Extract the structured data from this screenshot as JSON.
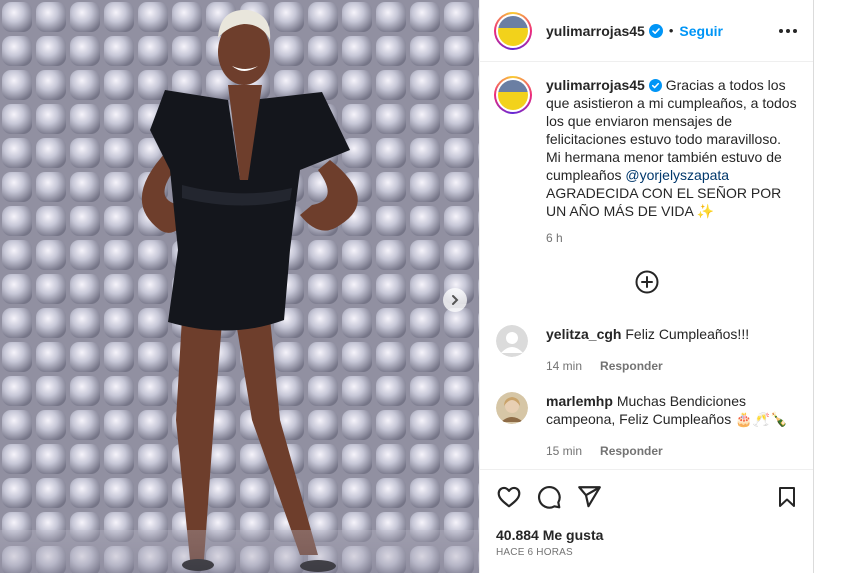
{
  "post": {
    "username": "yulimarrojas45",
    "dot": "•",
    "follow_label": "Seguir",
    "caption_text": "Gracias a todos los que asistieron a mi cumpleaños, a todos los que enviaron mensajes de felicitaciones estuvo todo maravilloso. Mi hermana menor también estuvo de cumpleaños ",
    "caption_mention": "@yorjelyszapata",
    "caption_end": " AGRADECIDA CON EL SEÑOR POR UN AÑO MÁS DE VIDA ✨",
    "caption_time": "6 h"
  },
  "comments": [
    {
      "username": "yelitza_cgh",
      "text": "Feliz Cumpleaños!!!",
      "time": "14 min",
      "reply_label": "Responder"
    },
    {
      "username": "marlemhp",
      "text": "Muchas Bendiciones campeona, Feliz Cumpleaños 🎂🥂🍾",
      "time": "15 min",
      "reply_label": "Responder"
    }
  ],
  "stats": {
    "likes": "40.884 Me gusta",
    "posted_ago": "HACE 6 HORAS"
  },
  "icons": {
    "verified": "verified-badge-icon",
    "more": "more-options-icon",
    "load_more": "add-circle-icon",
    "like": "heart-icon",
    "comment": "comment-icon",
    "share": "paper-plane-icon",
    "save": "bookmark-icon",
    "next": "chevron-right-icon"
  },
  "colors": {
    "accent": "#0095f6",
    "text": "#262626",
    "muted": "#737373",
    "mention": "#00376b"
  }
}
